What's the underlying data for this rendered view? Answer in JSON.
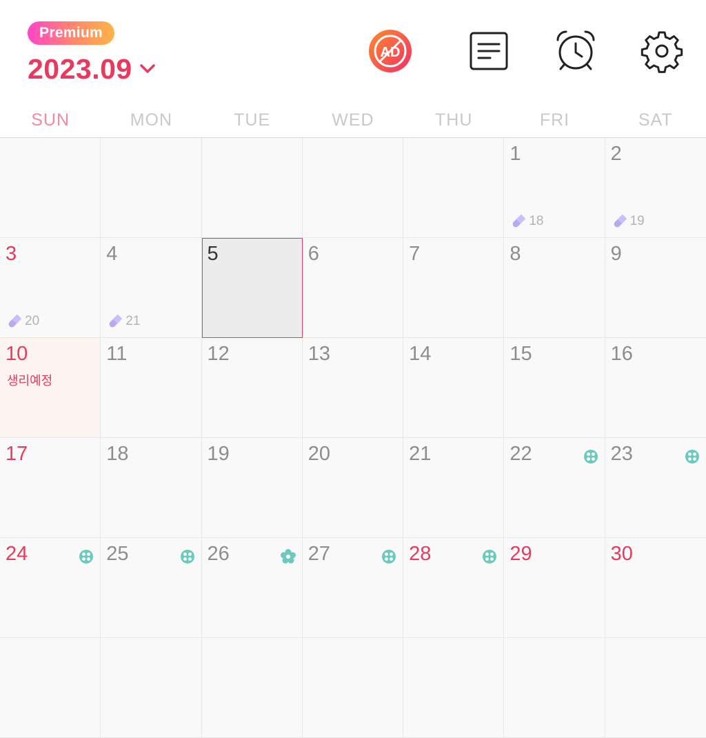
{
  "header": {
    "premium_label": "Premium",
    "month": "2023.09",
    "icons": [
      "remove-ads-icon",
      "memo-icon",
      "alarm-icon",
      "settings-icon"
    ]
  },
  "weekdays": [
    "SUN",
    "MON",
    "TUE",
    "WED",
    "THU",
    "FRI",
    "SAT"
  ],
  "colors": {
    "accent": "#e83a5e",
    "sunday_header": "#f38aa0",
    "pill": "#b9a8f2",
    "flower": "#6cc9be",
    "period_bg": "#fbf4f1",
    "today_bg": "#ececec"
  },
  "weeks": [
    [
      {
        "day": ""
      },
      {
        "day": ""
      },
      {
        "day": ""
      },
      {
        "day": ""
      },
      {
        "day": ""
      },
      {
        "day": "1",
        "pill": "18"
      },
      {
        "day": "2",
        "pill": "19"
      }
    ],
    [
      {
        "day": "3",
        "red": true,
        "pill": "20"
      },
      {
        "day": "4",
        "pill": "21"
      },
      {
        "day": "5",
        "today": true
      },
      {
        "day": "6"
      },
      {
        "day": "7"
      },
      {
        "day": "8"
      },
      {
        "day": "9"
      }
    ],
    [
      {
        "day": "10",
        "red": true,
        "period": true,
        "note": "생리예정"
      },
      {
        "day": "11"
      },
      {
        "day": "12"
      },
      {
        "day": "13"
      },
      {
        "day": "14"
      },
      {
        "day": "15"
      },
      {
        "day": "16"
      }
    ],
    [
      {
        "day": "17",
        "red": true
      },
      {
        "day": "18"
      },
      {
        "day": "19"
      },
      {
        "day": "20"
      },
      {
        "day": "21"
      },
      {
        "day": "22",
        "flower": "fertile-icon"
      },
      {
        "day": "23",
        "flower": "fertile-icon"
      }
    ],
    [
      {
        "day": "24",
        "red": true,
        "flower": "fertile-icon"
      },
      {
        "day": "25",
        "flower": "fertile-icon"
      },
      {
        "day": "26",
        "flower": "ovulation-icon"
      },
      {
        "day": "27",
        "flower": "fertile-icon"
      },
      {
        "day": "28",
        "red": true,
        "flower": "fertile-icon"
      },
      {
        "day": "29",
        "red": true
      },
      {
        "day": "30",
        "red": true
      }
    ],
    [
      {
        "day": ""
      },
      {
        "day": ""
      },
      {
        "day": ""
      },
      {
        "day": ""
      },
      {
        "day": ""
      },
      {
        "day": ""
      },
      {
        "day": ""
      }
    ]
  ]
}
